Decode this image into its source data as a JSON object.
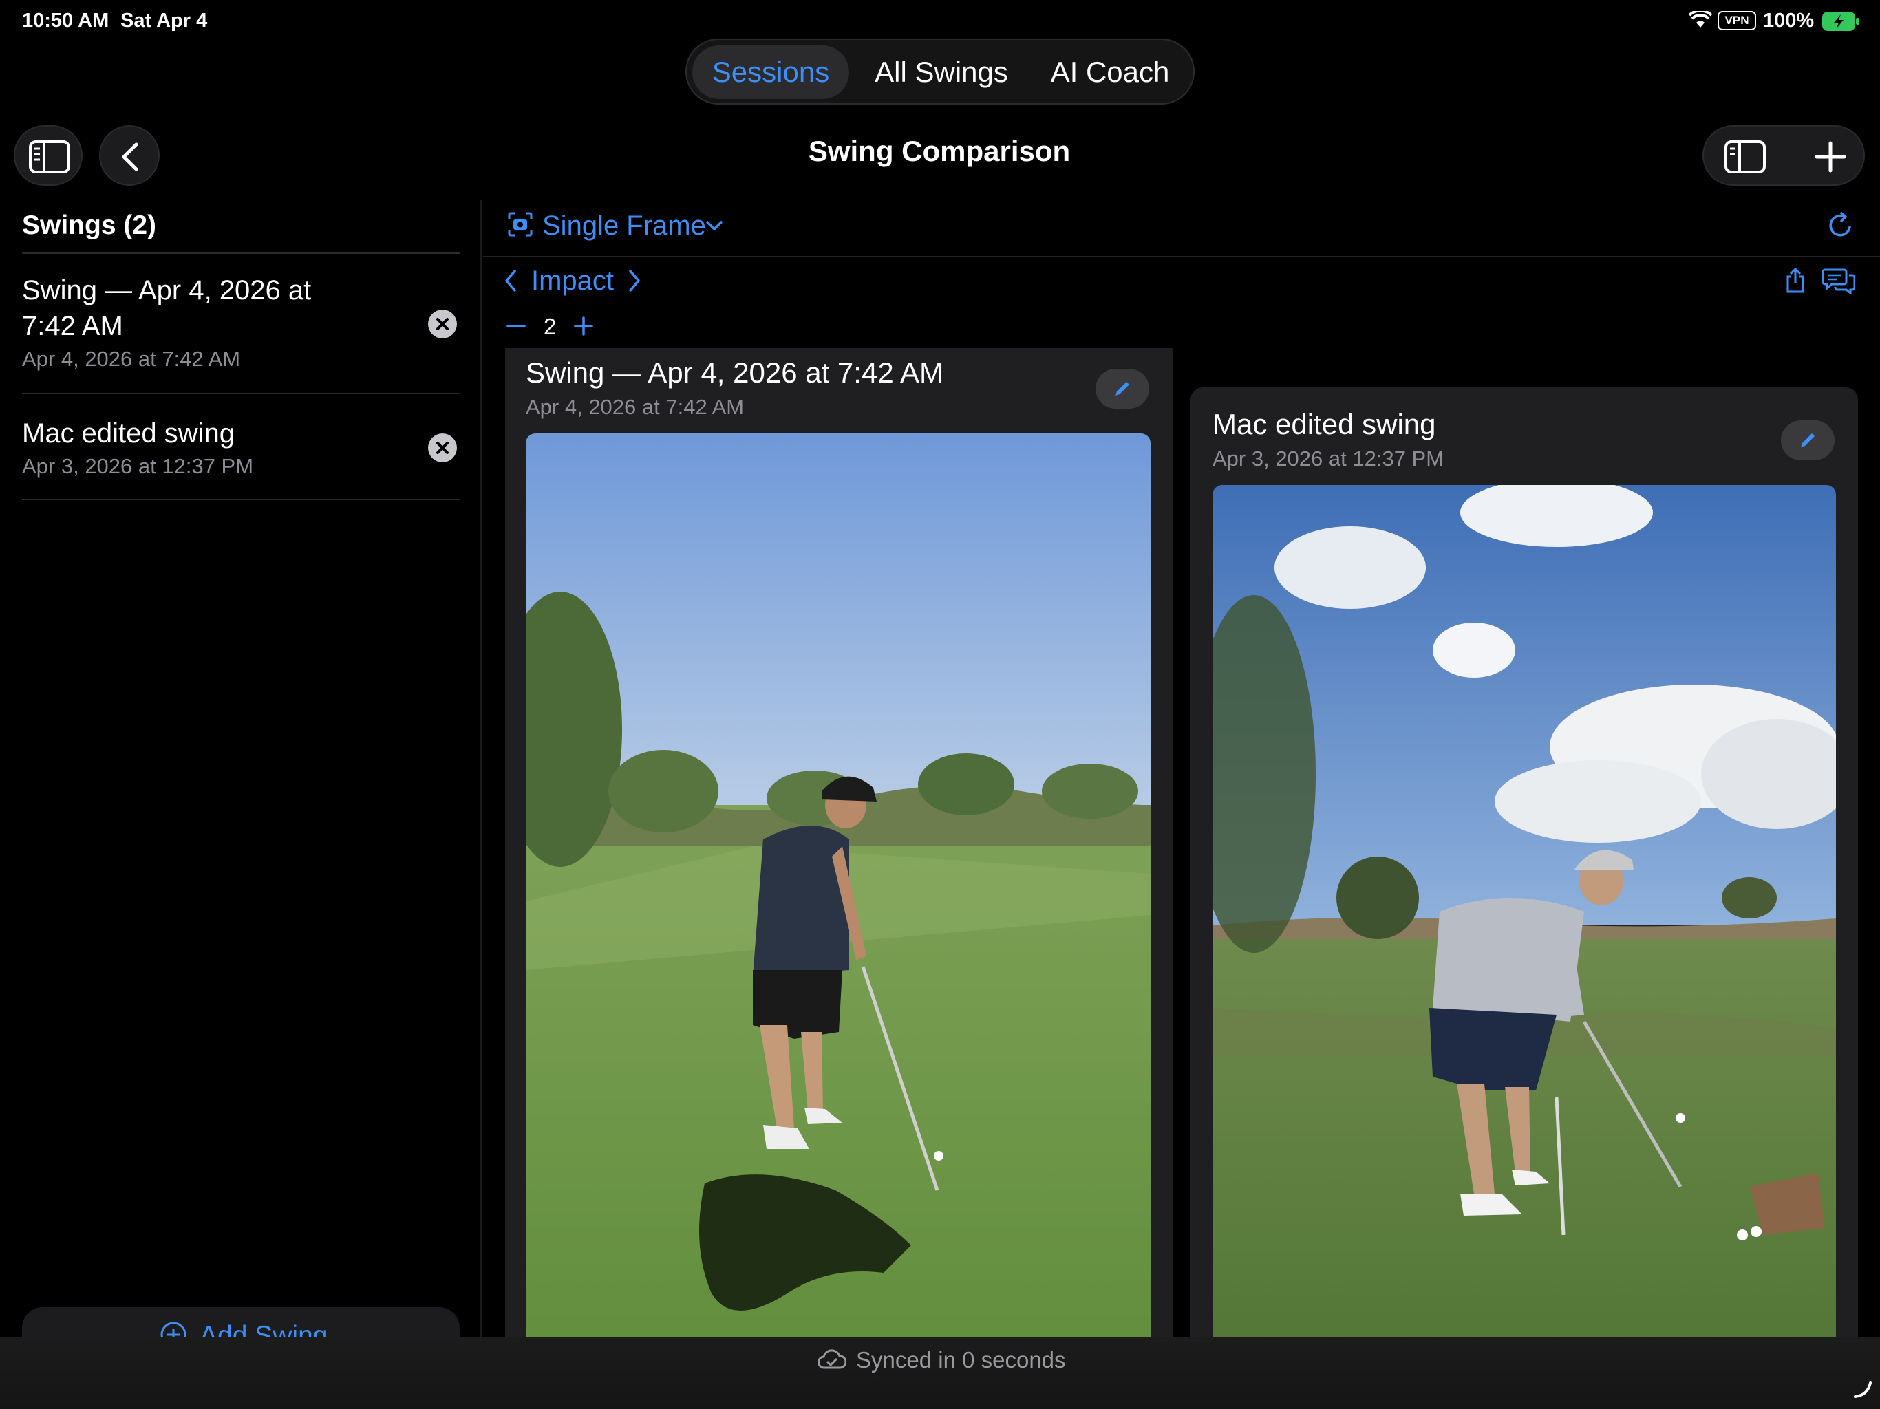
{
  "status_bar": {
    "time": "10:50 AM",
    "date": "Sat Apr 4",
    "vpn": "VPN",
    "battery": "100%"
  },
  "tabs": [
    {
      "label": "Sessions",
      "active": true
    },
    {
      "label": "All Swings",
      "active": false
    },
    {
      "label": "AI Coach",
      "active": false
    }
  ],
  "nav": {
    "title": "Swing Comparison"
  },
  "sidebar": {
    "header": "Swings (2)",
    "items": [
      {
        "title_line1": "Swing — Apr 4, 2026 at",
        "title_line2": "7:42 AM",
        "subtitle": "Apr 4, 2026 at 7:42 AM"
      },
      {
        "title_line1": "Mac edited swing",
        "subtitle": "Apr 3, 2026 at 12:37 PM"
      }
    ],
    "add_button": "Add Swing"
  },
  "toolbar": {
    "mode": "Single Frame",
    "phase": "Impact",
    "count": "2"
  },
  "cards": [
    {
      "title": "Swing — Apr 4, 2026 at 7:42 AM",
      "subtitle": "Apr 4, 2026 at 7:42 AM"
    },
    {
      "title": "Mac edited swing",
      "subtitle": "Apr 3, 2026 at 12:37 PM"
    }
  ],
  "sync": {
    "text": "Synced in 0 seconds"
  },
  "colors": {
    "accent": "#3d8ef5",
    "background": "#000000",
    "card": "#1f1f21"
  }
}
